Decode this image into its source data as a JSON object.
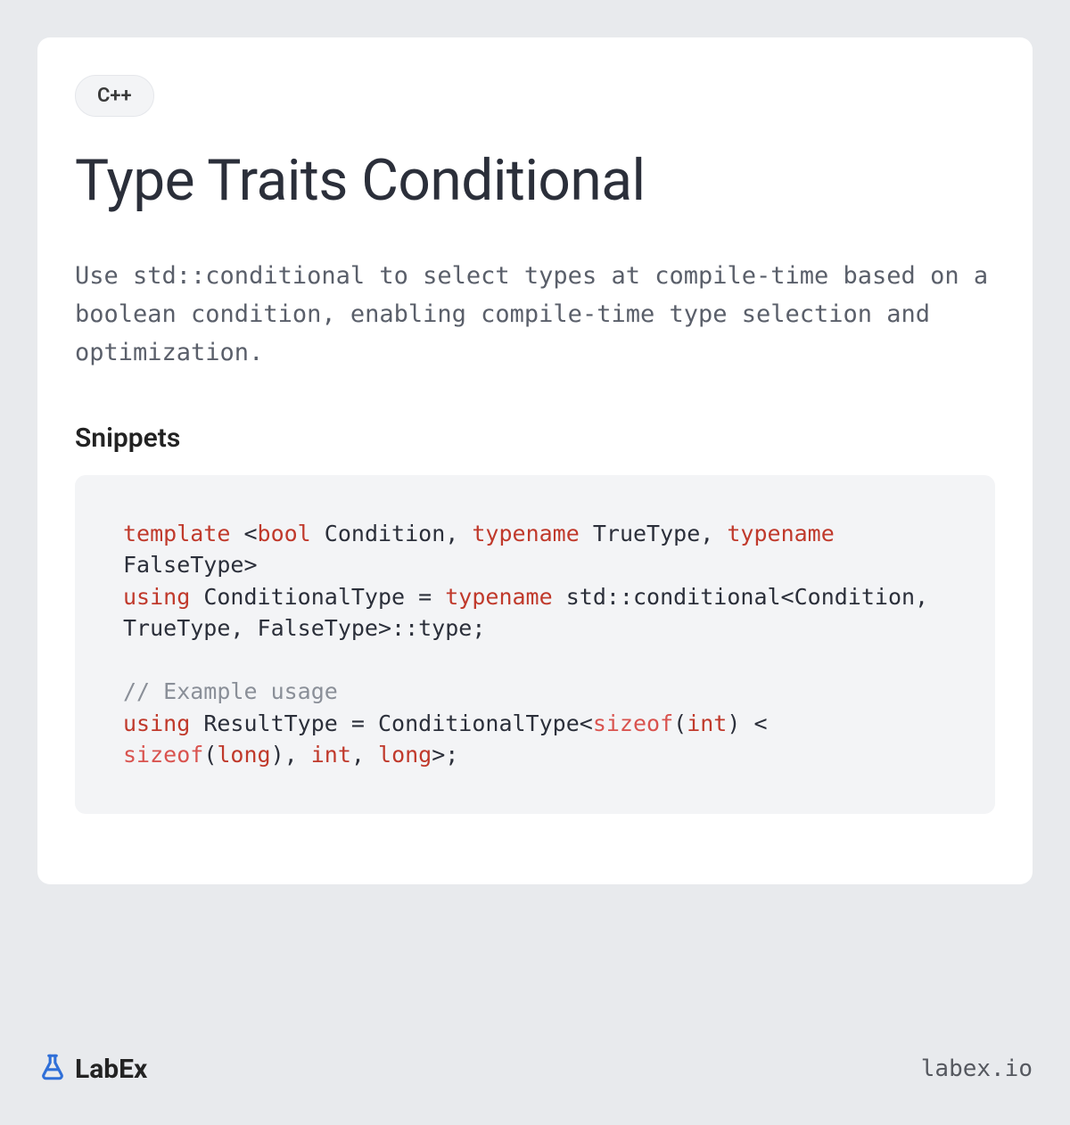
{
  "badge": "C++",
  "title": "Type Traits Conditional",
  "description": "Use std::conditional to select types at compile-time based on a boolean condition, enabling compile-time type selection and optimization.",
  "section_heading": "Snippets",
  "code": {
    "tokens": [
      {
        "t": "template",
        "c": "kw"
      },
      {
        "t": " <"
      },
      {
        "t": "bool",
        "c": "kw"
      },
      {
        "t": " Condition, "
      },
      {
        "t": "typename",
        "c": "kw"
      },
      {
        "t": " TrueType, "
      },
      {
        "t": "typename",
        "c": "kw"
      },
      {
        "t": " FalseType>\n"
      },
      {
        "t": "using",
        "c": "kw"
      },
      {
        "t": " ConditionalType = "
      },
      {
        "t": "typename",
        "c": "kw"
      },
      {
        "t": " std::conditional<Condition, TrueType, FalseType>::type;\n\n"
      },
      {
        "t": "// Example usage",
        "c": "comment"
      },
      {
        "t": "\n"
      },
      {
        "t": "using",
        "c": "kw"
      },
      {
        "t": " ResultType = ConditionalType<"
      },
      {
        "t": "sizeof",
        "c": "builtin"
      },
      {
        "t": "("
      },
      {
        "t": "int",
        "c": "kw"
      },
      {
        "t": ") < "
      },
      {
        "t": "sizeof",
        "c": "builtin"
      },
      {
        "t": "("
      },
      {
        "t": "long",
        "c": "kw"
      },
      {
        "t": "), "
      },
      {
        "t": "int",
        "c": "kw"
      },
      {
        "t": ", "
      },
      {
        "t": "long",
        "c": "kw"
      },
      {
        "t": ">;"
      }
    ]
  },
  "footer": {
    "brand": "LabEx",
    "url": "labex.io"
  }
}
